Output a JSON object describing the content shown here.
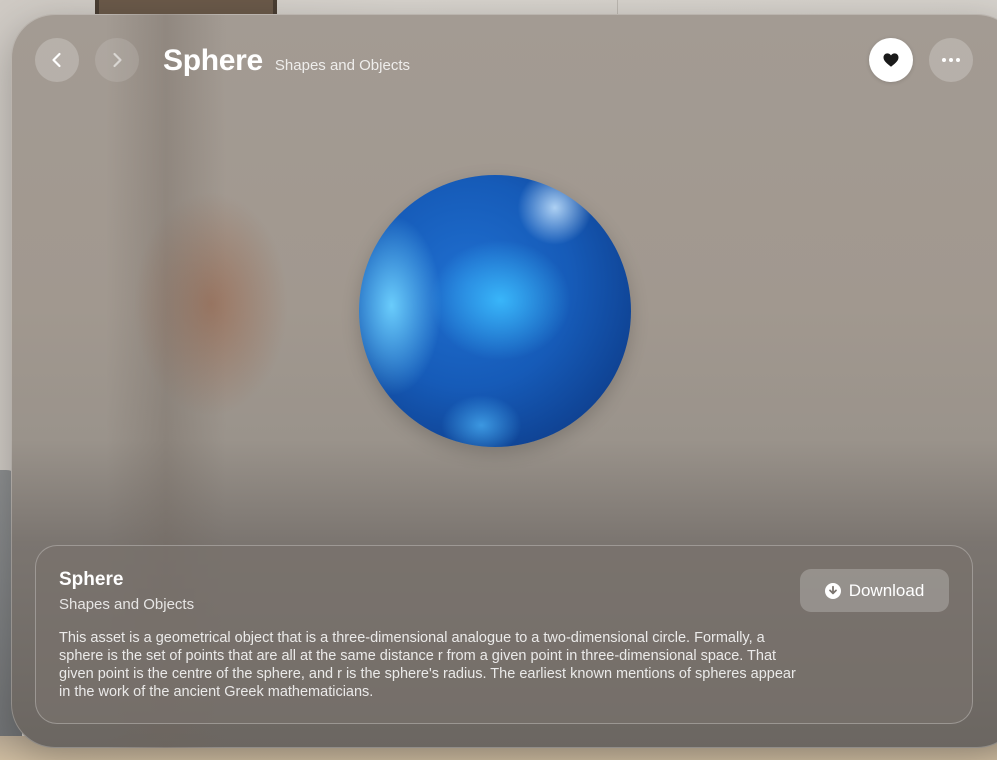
{
  "header": {
    "title": "Sphere",
    "subtitle": "Shapes and Objects"
  },
  "icons": {
    "back": "chevron-left-icon",
    "forward": "chevron-right-icon",
    "favorite": "heart-icon",
    "more": "ellipsis-icon",
    "download": "download-circle-icon"
  },
  "model": {
    "colors": [
      "#0e3f8e",
      "#1f6fd0",
      "#3cbeff"
    ]
  },
  "card": {
    "title": "Sphere",
    "subtitle": "Shapes and Objects",
    "description": "This asset is a geometrical object that is a three-dimensional analogue to a two-dimensional circle. Formally, a sphere is the set of points that are all at the same distance r from a given point in three-dimensional space. That given point is the centre of the sphere, and r is the sphere's radius. The earliest known mentions of spheres appear in the work of the ancient Greek mathematicians.",
    "download_label": "Download"
  }
}
